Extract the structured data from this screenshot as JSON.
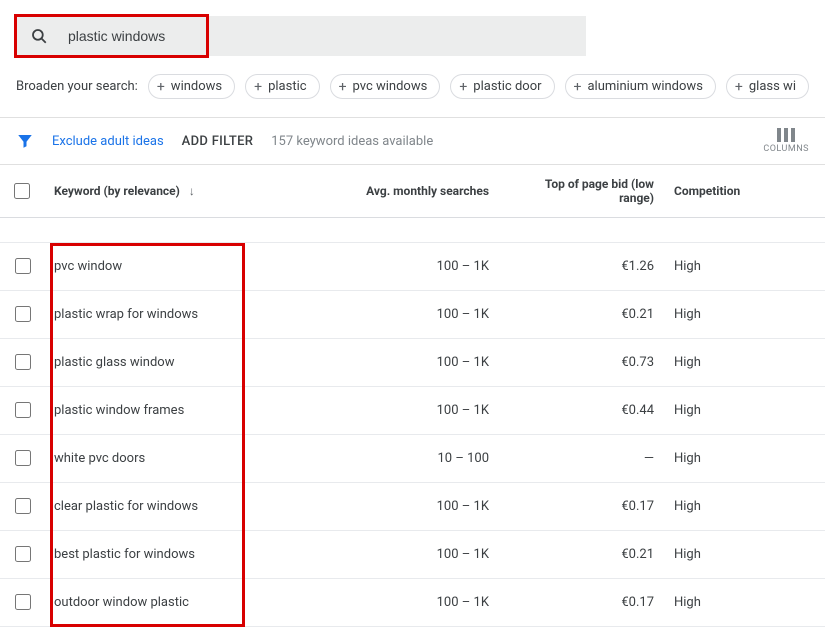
{
  "search": {
    "query": "plastic windows"
  },
  "broaden": {
    "label": "Broaden your search:",
    "chips": [
      "windows",
      "plastic",
      "pvc windows",
      "plastic door",
      "aluminium windows",
      "glass wi"
    ]
  },
  "filters": {
    "exclude": "Exclude adult ideas",
    "add_filter": "ADD FILTER",
    "ideas_count": "157 keyword ideas available",
    "columns_label": "COLUMNS"
  },
  "table": {
    "headers": {
      "keyword": "Keyword (by relevance)",
      "avg": "Avg. monthly searches",
      "bid": "Top of page bid (low range)",
      "competition": "Competition"
    },
    "rows": [
      {
        "keyword": "pvc window",
        "avg": "100 – 1K",
        "bid": "€1.26",
        "competition": "High"
      },
      {
        "keyword": "plastic wrap for windows",
        "avg": "100 – 1K",
        "bid": "€0.21",
        "competition": "High"
      },
      {
        "keyword": "plastic glass window",
        "avg": "100 – 1K",
        "bid": "€0.73",
        "competition": "High"
      },
      {
        "keyword": "plastic window frames",
        "avg": "100 – 1K",
        "bid": "€0.44",
        "competition": "High"
      },
      {
        "keyword": "white pvc doors",
        "avg": "10 – 100",
        "bid": "—",
        "competition": "High"
      },
      {
        "keyword": "clear plastic for windows",
        "avg": "100 – 1K",
        "bid": "€0.17",
        "competition": "High"
      },
      {
        "keyword": "best plastic for windows",
        "avg": "100 – 1K",
        "bid": "€0.21",
        "competition": "High"
      },
      {
        "keyword": "outdoor window plastic",
        "avg": "100 – 1K",
        "bid": "€0.17",
        "competition": "High"
      }
    ]
  }
}
